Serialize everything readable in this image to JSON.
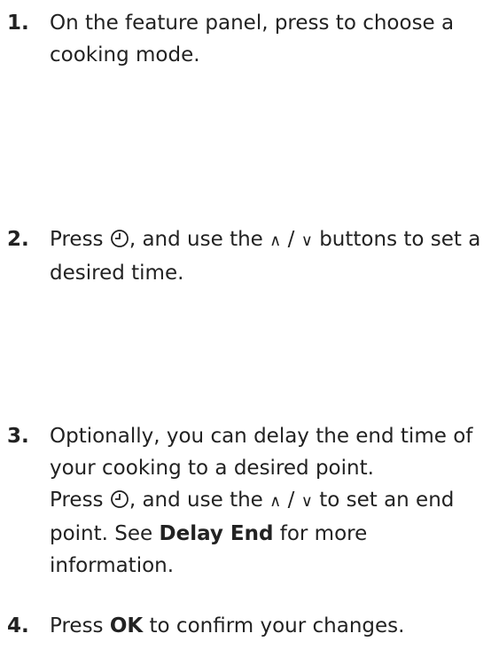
{
  "steps": [
    {
      "number": "1.",
      "text_a": "On the feature panel, press to choose a cooking mode."
    },
    {
      "number": "2.",
      "text_a": "Press ",
      "text_b": ", and use the ",
      "up_symbol": "∧",
      "separator": " / ",
      "down_symbol": "∨",
      "text_c": " buttons to set a desired time."
    },
    {
      "number": "3.",
      "text_a": "Optionally, you can delay the end time of your cooking to a desired point.",
      "text_b": "Press ",
      "text_c": ", and use the ",
      "up_symbol": "∧",
      "separator": " / ",
      "down_symbol": "∨",
      "text_d": " to set an end point. See ",
      "link": "Delay End",
      "text_e": " for more information."
    },
    {
      "number": "4.",
      "text_a": "Press ",
      "ok_label": "OK",
      "text_b": " to confirm your changes."
    }
  ]
}
